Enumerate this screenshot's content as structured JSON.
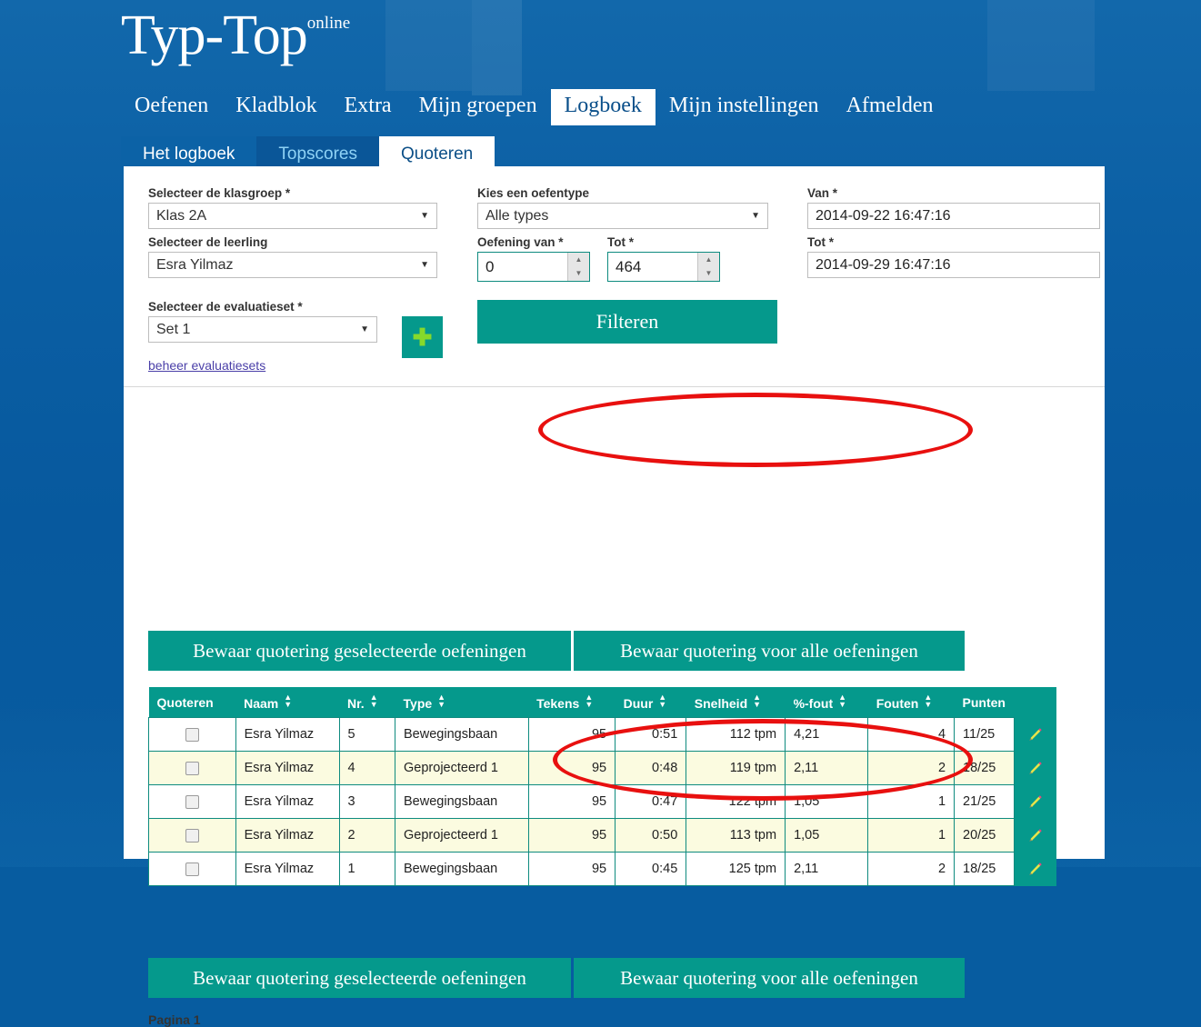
{
  "brand": {
    "name": "Typ-Top",
    "superscript": "online"
  },
  "mainnav": [
    {
      "label": "Oefenen",
      "active": false
    },
    {
      "label": "Kladblok",
      "active": false
    },
    {
      "label": "Extra",
      "active": false
    },
    {
      "label": "Mijn groepen",
      "active": false
    },
    {
      "label": "Logboek",
      "active": true
    },
    {
      "label": "Mijn instellingen",
      "active": false
    },
    {
      "label": "Afmelden",
      "active": false
    }
  ],
  "tabs": [
    {
      "label": "Het logboek",
      "active": false
    },
    {
      "label": "Topscores",
      "active": false
    },
    {
      "label": "Quoteren",
      "active": true
    }
  ],
  "form": {
    "klasgroep": {
      "label": "Selecteer de klasgroep *",
      "value": "Klas 2A"
    },
    "leerling": {
      "label": "Selecteer de leerling",
      "value": "Esra Yilmaz"
    },
    "evaluatieset": {
      "label": "Selecteer de evaluatieset *",
      "value": "Set 1"
    },
    "add_set_icon": "plus-icon",
    "beheer_link": "beheer evaluatiesets",
    "oefentype": {
      "label": "Kies een oefentype",
      "value": "Alle types"
    },
    "oefening_van": {
      "label": "Oefening van *",
      "value": "0"
    },
    "oefening_tot": {
      "label": "Tot *",
      "value": "464"
    },
    "filter_button": "Filteren",
    "van": {
      "label": "Van *",
      "value": "2014-09-22 16:47:16"
    },
    "tot": {
      "label": "Tot *",
      "value": "2014-09-29 16:47:16"
    }
  },
  "actions": {
    "save_selected": "Bewaar quotering geselecteerde oefeningen",
    "save_all": "Bewaar quotering voor alle oefeningen"
  },
  "table": {
    "columns": [
      {
        "label": "Quoteren",
        "sortable": false
      },
      {
        "label": "Naam",
        "sortable": true
      },
      {
        "label": "Nr.",
        "sortable": true
      },
      {
        "label": "Type",
        "sortable": true
      },
      {
        "label": "Tekens",
        "sortable": true
      },
      {
        "label": "Duur",
        "sortable": true
      },
      {
        "label": "Snelheid",
        "sortable": true
      },
      {
        "label": "%-fout",
        "sortable": true
      },
      {
        "label": "Fouten",
        "sortable": true
      },
      {
        "label": "Punten",
        "sortable": false
      }
    ],
    "rows": [
      {
        "naam": "Esra Yilmaz",
        "nr": "5",
        "type": "Bewegingsbaan",
        "tekens": "95",
        "duur": "0:51",
        "snelheid": "112 tpm",
        "fout_pct": "4,21",
        "fouten": "4",
        "punten": "11/25"
      },
      {
        "naam": "Esra Yilmaz",
        "nr": "4",
        "type": "Geprojecteerd 1",
        "tekens": "95",
        "duur": "0:48",
        "snelheid": "119 tpm",
        "fout_pct": "2,11",
        "fouten": "2",
        "punten": "18/25"
      },
      {
        "naam": "Esra Yilmaz",
        "nr": "3",
        "type": "Bewegingsbaan",
        "tekens": "95",
        "duur": "0:47",
        "snelheid": "122 tpm",
        "fout_pct": "1,05",
        "fouten": "1",
        "punten": "21/25"
      },
      {
        "naam": "Esra Yilmaz",
        "nr": "2",
        "type": "Geprojecteerd 1",
        "tekens": "95",
        "duur": "0:50",
        "snelheid": "113 tpm",
        "fout_pct": "1,05",
        "fouten": "1",
        "punten": "20/25"
      },
      {
        "naam": "Esra Yilmaz",
        "nr": "1",
        "type": "Bewegingsbaan",
        "tekens": "95",
        "duur": "0:45",
        "snelheid": "125 tpm",
        "fout_pct": "2,11",
        "fouten": "2",
        "punten": "18/25"
      }
    ],
    "edit_icon": "pencil-icon"
  },
  "pagination": {
    "label": "Pagina 1"
  },
  "annotations": [
    {
      "name": "highlight-ellipse-top",
      "shape": "ellipse",
      "color": "#e8100f"
    },
    {
      "name": "highlight-ellipse-bottom",
      "shape": "ellipse",
      "color": "#e8100f"
    }
  ],
  "colors": {
    "brand_blue": "#0c5f9f",
    "accent_teal": "#05998c",
    "annotation_red": "#e8100f",
    "row_alt": "#fbfbe0"
  }
}
